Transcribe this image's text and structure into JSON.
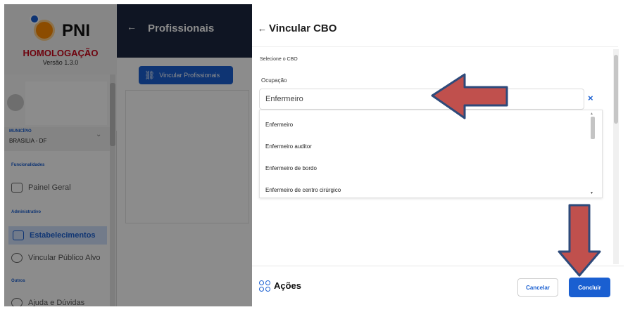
{
  "sidebar": {
    "app_name": "PNI",
    "environment": "HOMOLOGAÇÃO",
    "version": "Versão 1.3.0",
    "municipio_label": "MUNICÍPIO",
    "municipio_value": "BRASILIA - DF",
    "sections": {
      "funcionalidades": "Funcionalidades",
      "administrativo": "Administrativo",
      "outros": "Outros"
    },
    "items": [
      {
        "label": "Painel Geral"
      },
      {
        "label": "Estabelecimentos"
      },
      {
        "label": "Vincular Público Alvo"
      },
      {
        "label": "Ajuda e Dúvidas"
      }
    ]
  },
  "main": {
    "title": "Profissionais",
    "vincular_button": "Vincular Profissionais"
  },
  "dialog": {
    "title": "Vincular CBO",
    "section_label": "Selecione o CBO",
    "field_label": "Ocupação",
    "input_value": "Enfermeiro",
    "clear_symbol": "×",
    "options": [
      "Enfermeiro",
      "Enfermeiro auditor",
      "Enfermeiro de bordo",
      "Enfermeiro de centro cirúrgico"
    ],
    "actions_label": "Ações",
    "cancel_label": "Cancelar",
    "confirm_label": "Concluir"
  },
  "colors": {
    "primary": "#1a5fd1",
    "header_dark": "#1d2740",
    "homolog_red": "#c9071b",
    "arrow_fill": "#c0504d",
    "arrow_stroke": "#2e4a7a"
  },
  "icons": [
    "back-arrow-icon",
    "link-icon",
    "close-icon",
    "actions-grid-icon",
    "painel-icon",
    "building-icon",
    "user-icon"
  ]
}
